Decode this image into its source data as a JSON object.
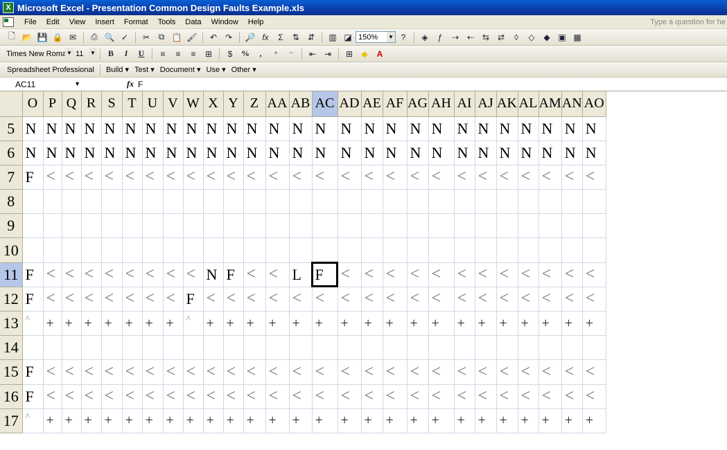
{
  "window": {
    "title": "Microsoft Excel - Presentation Common Design Faults Example.xls"
  },
  "menu": {
    "items": [
      "File",
      "Edit",
      "View",
      "Insert",
      "Format",
      "Tools",
      "Data",
      "Window",
      "Help"
    ],
    "ask_placeholder": "Type a question for he"
  },
  "standard_toolbar": {
    "zoom": "150%"
  },
  "formatting_toolbar": {
    "font": "Times New Roman",
    "size": "11"
  },
  "addin_toolbar": {
    "title": "Spreadsheet Professional",
    "menus": [
      "Build ▾",
      "Test ▾",
      "Document ▾",
      "Use ▾",
      "Other ▾"
    ]
  },
  "formula_bar": {
    "cell_ref": "AC11",
    "content": "F"
  },
  "sheet": {
    "columns": [
      "O",
      "P",
      "Q",
      "R",
      "S",
      "T",
      "U",
      "V",
      "W",
      "X",
      "Y",
      "Z",
      "AA",
      "AB",
      "AC",
      "AD",
      "AE",
      "AF",
      "AG",
      "AH",
      "AI",
      "AJ",
      "AK",
      "AL",
      "AM",
      "AN",
      "AO"
    ],
    "active_column": "AC",
    "active_row": "11",
    "rows": [
      {
        "num": "5",
        "cells": [
          "N",
          "N",
          "N",
          "N",
          "N",
          "N",
          "N",
          "N",
          "N",
          "N",
          "N",
          "N",
          "N",
          "N",
          "N",
          "N",
          "N",
          "N",
          "N",
          "N",
          "N",
          "N",
          "N",
          "N",
          "N",
          "N",
          "N"
        ]
      },
      {
        "num": "6",
        "cells": [
          "N",
          "N",
          "N",
          "N",
          "N",
          "N",
          "N",
          "N",
          "N",
          "N",
          "N",
          "N",
          "N",
          "N",
          "N",
          "N",
          "N",
          "N",
          "N",
          "N",
          "N",
          "N",
          "N",
          "N",
          "N",
          "N",
          "N"
        ]
      },
      {
        "num": "7",
        "cells": [
          "F",
          "<",
          "<",
          "<",
          "<",
          "<",
          "<",
          "<",
          "<",
          "<",
          "<",
          "<",
          "<",
          "<",
          "<",
          "<",
          "<",
          "<",
          "<",
          "<",
          "<",
          "<",
          "<",
          "<",
          "<",
          "<",
          "<"
        ]
      },
      {
        "num": "8",
        "cells": [
          "",
          "",
          "",
          "",
          "",
          "",
          "",
          "",
          "",
          "",
          "",
          "",
          "",
          "",
          "",
          "",
          "",
          "",
          "",
          "",
          "",
          "",
          "",
          "",
          "",
          "",
          ""
        ]
      },
      {
        "num": "9",
        "cells": [
          "",
          "",
          "",
          "",
          "",
          "",
          "",
          "",
          "",
          "",
          "",
          "",
          "",
          "",
          "",
          "",
          "",
          "",
          "",
          "",
          "",
          "",
          "",
          "",
          "",
          "",
          ""
        ]
      },
      {
        "num": "10",
        "cells": [
          "",
          "",
          "",
          "",
          "",
          "",
          "",
          "",
          "",
          "",
          "",
          "",
          "",
          "",
          "",
          "",
          "",
          "",
          "",
          "",
          "",
          "",
          "",
          "",
          "",
          "",
          ""
        ]
      },
      {
        "num": "11",
        "cells": [
          "F",
          "<",
          "<",
          "<",
          "<",
          "<",
          "<",
          "<",
          "<",
          "N",
          "F",
          "<",
          "<",
          "L",
          "F",
          "<",
          "<",
          "<",
          "<",
          "<",
          "<",
          "<",
          "<",
          "<",
          "<",
          "<",
          "<"
        ]
      },
      {
        "num": "12",
        "cells": [
          "F",
          "<",
          "<",
          "<",
          "<",
          "<",
          "<",
          "<",
          "F",
          "<",
          "<",
          "<",
          "<",
          "<",
          "<",
          "<",
          "<",
          "<",
          "<",
          "<",
          "<",
          "<",
          "<",
          "<",
          "<",
          "<",
          "<"
        ]
      },
      {
        "num": "13",
        "cells": [
          "^",
          "+",
          "+",
          "+",
          "+",
          "+",
          "+",
          "+",
          "^",
          "+",
          "+",
          "+",
          "+",
          "+",
          "+",
          "+",
          "+",
          "+",
          "+",
          "+",
          "+",
          "+",
          "+",
          "+",
          "+",
          "+",
          "+"
        ]
      },
      {
        "num": "14",
        "cells": [
          "",
          "",
          "",
          "",
          "",
          "",
          "",
          "",
          "",
          "",
          "",
          "",
          "",
          "",
          "",
          "",
          "",
          "",
          "",
          "",
          "",
          "",
          "",
          "",
          "",
          "",
          ""
        ]
      },
      {
        "num": "15",
        "cells": [
          "F",
          "<",
          "<",
          "<",
          "<",
          "<",
          "<",
          "<",
          "<",
          "<",
          "<",
          "<",
          "<",
          "<",
          "<",
          "<",
          "<",
          "<",
          "<",
          "<",
          "<",
          "<",
          "<",
          "<",
          "<",
          "<",
          "<"
        ]
      },
      {
        "num": "16",
        "cells": [
          "F",
          "<",
          "<",
          "<",
          "<",
          "<",
          "<",
          "<",
          "<",
          "<",
          "<",
          "<",
          "<",
          "<",
          "<",
          "<",
          "<",
          "<",
          "<",
          "<",
          "<",
          "<",
          "<",
          "<",
          "<",
          "<",
          "<"
        ]
      },
      {
        "num": "17",
        "cells": [
          "^",
          "+",
          "+",
          "+",
          "+",
          "+",
          "+",
          "+",
          "+",
          "+",
          "+",
          "+",
          "+",
          "+",
          "+",
          "+",
          "+",
          "+",
          "+",
          "+",
          "+",
          "+",
          "+",
          "+",
          "+",
          "+",
          "+"
        ]
      }
    ]
  }
}
